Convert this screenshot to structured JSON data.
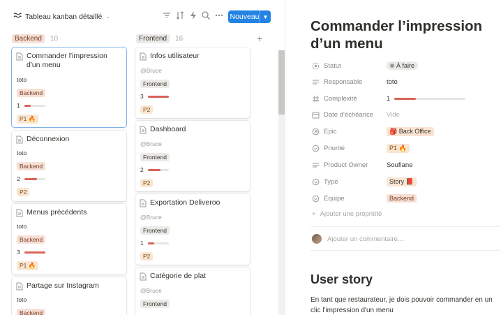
{
  "toolbar": {
    "view_name": "Tableau kanban détaillé",
    "new_label": "Nouveau"
  },
  "board": {
    "add_column": "+",
    "columns": [
      {
        "name": "Backend",
        "count": "10",
        "cards": [
          {
            "title": "Commander l'impression d'un menu",
            "person": "toto",
            "tag": "Backend",
            "progress_label": "1",
            "progress": 0.3,
            "priority": "P1 🔥"
          },
          {
            "title": "Déconnexion",
            "person": "toto",
            "tag": "Backend",
            "progress_label": "2",
            "progress": 0.6,
            "priority": "P2"
          },
          {
            "title": "Menus précédents",
            "person": "toto",
            "tag": "Backend",
            "progress_label": "3",
            "progress": 1.0,
            "priority": "P1 🔥"
          },
          {
            "title": "Partage sur Instagram",
            "person": "toto",
            "tag": "Backend"
          }
        ]
      },
      {
        "name": "Frontend",
        "count": "16",
        "cards": [
          {
            "title": "Infos utilisateur",
            "person": "@Bruce",
            "tag": "Frontend",
            "progress_label": "3",
            "progress": 1.0,
            "priority": "P2"
          },
          {
            "title": "Dashboard",
            "person": "@Bruce",
            "tag": "Frontend",
            "progress_label": "2",
            "progress": 0.6,
            "priority": "P2"
          },
          {
            "title": "Exportation Deliveroo",
            "person": "@Bruce",
            "tag": "Frontend",
            "progress_label": "1",
            "progress": 0.3,
            "priority": "P2"
          },
          {
            "title": "Catégorie de plat",
            "person": "@Bruce",
            "tag": "Frontend"
          }
        ]
      }
    ]
  },
  "detail": {
    "title": "Commander l’impression d’un menu",
    "props": [
      {
        "label": "Statut",
        "value": "À faire"
      },
      {
        "label": "Responsable",
        "value": "toto"
      },
      {
        "label": "Complexité",
        "value": "1",
        "progress": 0.3
      },
      {
        "label": "Date d'échéance",
        "value": "Vide"
      },
      {
        "label": "Epic",
        "value": "🎒 Back Office"
      },
      {
        "label": "Priorité",
        "value": "P1 🔥"
      },
      {
        "label": "Product Owner",
        "value": "Soufiane"
      },
      {
        "label": "Type",
        "value": "Story 📕"
      },
      {
        "label": "Équipe",
        "value": "Backend"
      }
    ],
    "add_property": "Ajouter une propriété",
    "comment_placeholder": "Ajouter un commentaire...",
    "heading": "User story",
    "paragraph": "En tant que restaurateur, je dois pouvoir commander en un clic l'impression d'un menu"
  },
  "colors": {
    "accent": "#2383e2",
    "progress": "#d9625a",
    "backend_tag": "#f6e0d6",
    "frontend_tag": "#ebeae7",
    "priority_tag": "#f9e6d2"
  }
}
